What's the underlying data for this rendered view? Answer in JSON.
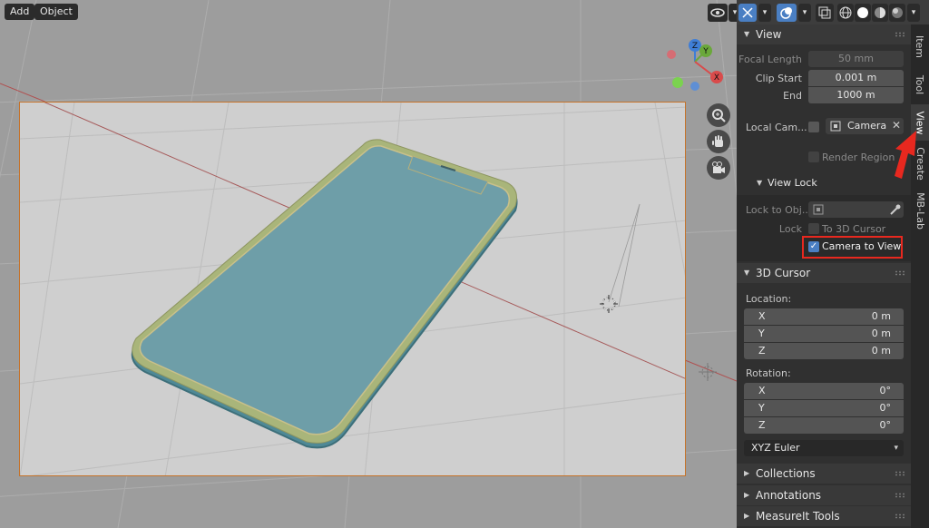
{
  "header": {
    "add_label": "Add",
    "object_label": "Object"
  },
  "toolbar_icons": [
    "visibility-icon",
    "gizmo-icon",
    "overlay-icon",
    "xray-icon",
    "wireframe-shading-icon",
    "solid-shading-icon",
    "material-shading-icon",
    "rendered-shading-icon"
  ],
  "gizmo": {
    "z": "Z",
    "y": "Y",
    "x": "X"
  },
  "tabs": {
    "item": "Item",
    "tool": "Tool",
    "view": "View",
    "create": "Create",
    "mblab": "MB-Lab"
  },
  "view_panel": {
    "title": "View",
    "focal_length_label": "Focal Length",
    "focal_length_value": "50 mm",
    "clip_start_label": "Clip Start",
    "clip_start_value": "0.001 m",
    "end_label": "End",
    "end_value": "1000 m",
    "local_camera_label": "Local Cam...",
    "local_camera_value": "Camera",
    "render_region_label": "Render Region"
  },
  "view_lock": {
    "title": "View Lock",
    "lock_to_object_label": "Lock to Obj...",
    "lock_label": "Lock",
    "to_3d_cursor_label": "To 3D Cursor",
    "camera_to_view_label": "Camera to View",
    "camera_to_view_checked": true
  },
  "cursor_panel": {
    "title": "3D Cursor",
    "location_label": "Location:",
    "location": [
      {
        "axis": "X",
        "value": "0 m"
      },
      {
        "axis": "Y",
        "value": "0 m"
      },
      {
        "axis": "Z",
        "value": "0 m"
      }
    ],
    "rotation_label": "Rotation:",
    "rotation": [
      {
        "axis": "X",
        "value": "0°"
      },
      {
        "axis": "Y",
        "value": "0°"
      },
      {
        "axis": "Z",
        "value": "0°"
      }
    ],
    "rotation_mode": "XYZ Euler"
  },
  "collapsed_panels": {
    "collections": "Collections",
    "annotations": "Annotations",
    "measureit": "MeasureIt Tools"
  },
  "colors": {
    "highlight_red": "#e8281f",
    "accent_blue": "#4a7fc3",
    "camera_frame": "#c5732a",
    "phone_screen": "#6e9ea8"
  }
}
